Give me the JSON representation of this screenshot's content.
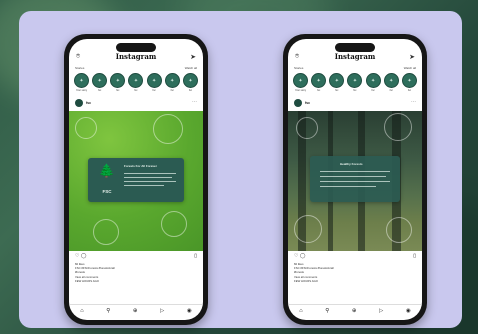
{
  "colors": {
    "card_bg": "#c9c8ee",
    "story_ring": "#2e6e5c",
    "post_green": "#5aa82e",
    "teal_box": "#2b5b52"
  },
  "phones": [
    {
      "topbar": {
        "brand": "Instagram",
        "left_icon": "camera-icon",
        "right_icon": "send-icon"
      },
      "stories_header": {
        "left": "Stories",
        "right": "Watch all"
      },
      "stories": [
        {
          "label": "Your story"
        },
        {
          "label": "fsc"
        },
        {
          "label": "fsc"
        },
        {
          "label": "fsc"
        },
        {
          "label": "fsc"
        },
        {
          "label": "fsc"
        },
        {
          "label": "fsc"
        }
      ],
      "post": {
        "username": "fsc",
        "logo_text": "FSC",
        "box_title": "Forests For All Forever",
        "likes": "82 likes",
        "caption_1": "FSC #FSCForests #forestsforall",
        "caption_2": "#forests",
        "comments": "View all comments",
        "time": "FEW HOURS AGO"
      }
    },
    {
      "topbar": {
        "brand": "Instagram",
        "left_icon": "camera-icon",
        "right_icon": "send-icon"
      },
      "stories_header": {
        "left": "Stories",
        "right": "Watch all"
      },
      "stories": [
        {
          "label": "Your story"
        },
        {
          "label": "fsc"
        },
        {
          "label": "fsc"
        },
        {
          "label": "fsc"
        },
        {
          "label": "fsc"
        },
        {
          "label": "fsc"
        },
        {
          "label": "fsc"
        }
      ],
      "post": {
        "username": "fsc",
        "box_title": "Healthy Forests",
        "likes": "82 likes",
        "caption_1": "FSC #FSCForests #forestsforall",
        "caption_2": "#forests",
        "comments": "View all comments",
        "time": "FEW HOURS AGO"
      }
    }
  ],
  "nav_icons": [
    "home-icon",
    "search-icon",
    "add-icon",
    "reels-icon",
    "profile-icon"
  ]
}
